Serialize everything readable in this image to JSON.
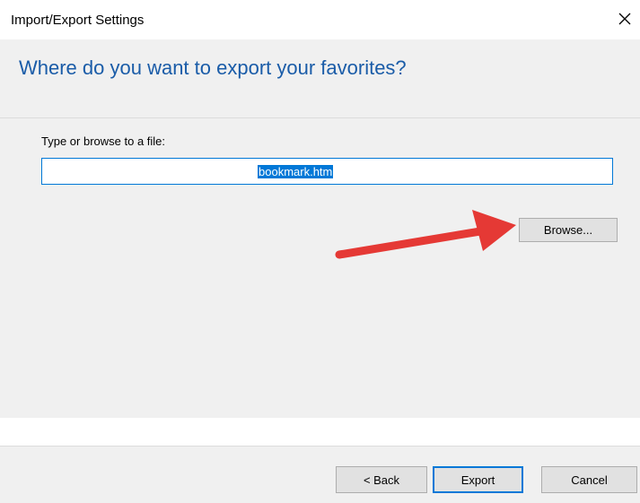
{
  "window": {
    "title": "Import/Export Settings",
    "close_icon": "close-icon"
  },
  "header": {
    "heading": "Where do you want to export your favorites?"
  },
  "form": {
    "field_label": "Type or browse to a file:",
    "file_value": "bookmark.htm",
    "browse_label": "Browse..."
  },
  "footer": {
    "back_label": "< Back",
    "export_label": "Export",
    "cancel_label": "Cancel"
  },
  "colors": {
    "heading": "#1a5ca8",
    "selection": "#0078d7",
    "panel": "#f0f0f0",
    "annotation_arrow": "#e53935"
  }
}
